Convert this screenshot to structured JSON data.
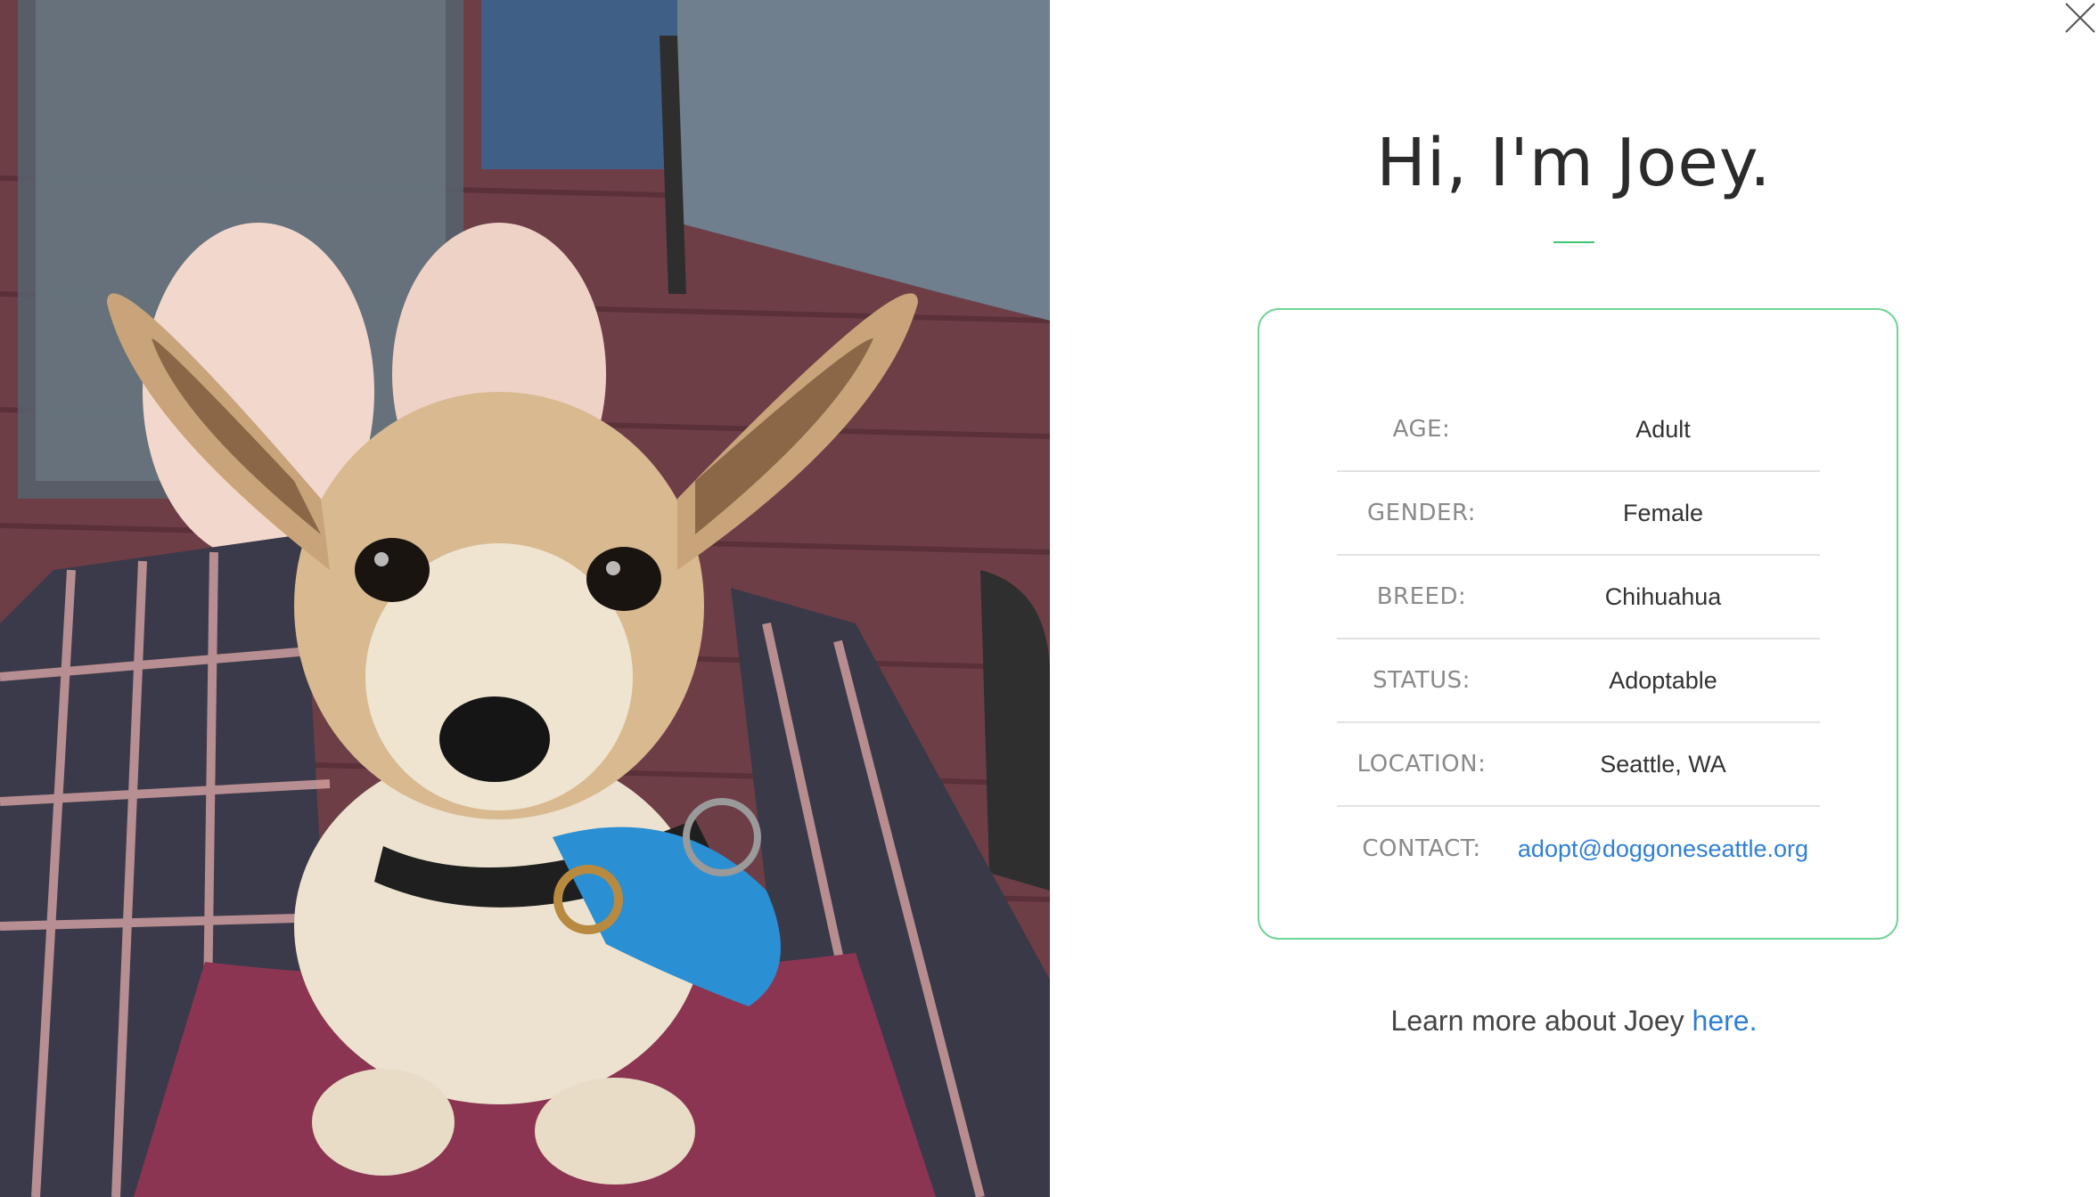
{
  "photo": {
    "alt": "Joey"
  },
  "close": {
    "icon": "close-icon"
  },
  "profile": {
    "title": "Hi, I'm Joey.",
    "accent_color": "#3fc274",
    "card_border_color": "#6fd597",
    "link_color": "#2f7fd6"
  },
  "details": [
    {
      "label": "AGE:",
      "value": "Adult"
    },
    {
      "label": "GENDER:",
      "value": "Female"
    },
    {
      "label": "BREED:",
      "value": "Chihuahua"
    },
    {
      "label": "STATUS:",
      "value": "Adoptable"
    },
    {
      "label": "LOCATION:",
      "value": "Seattle, WA"
    },
    {
      "label": "CONTACT:",
      "value": "adopt@doggoneseattle.org"
    }
  ],
  "learn_more": {
    "prefix": "Learn more about Joey",
    "link_text": "here."
  }
}
